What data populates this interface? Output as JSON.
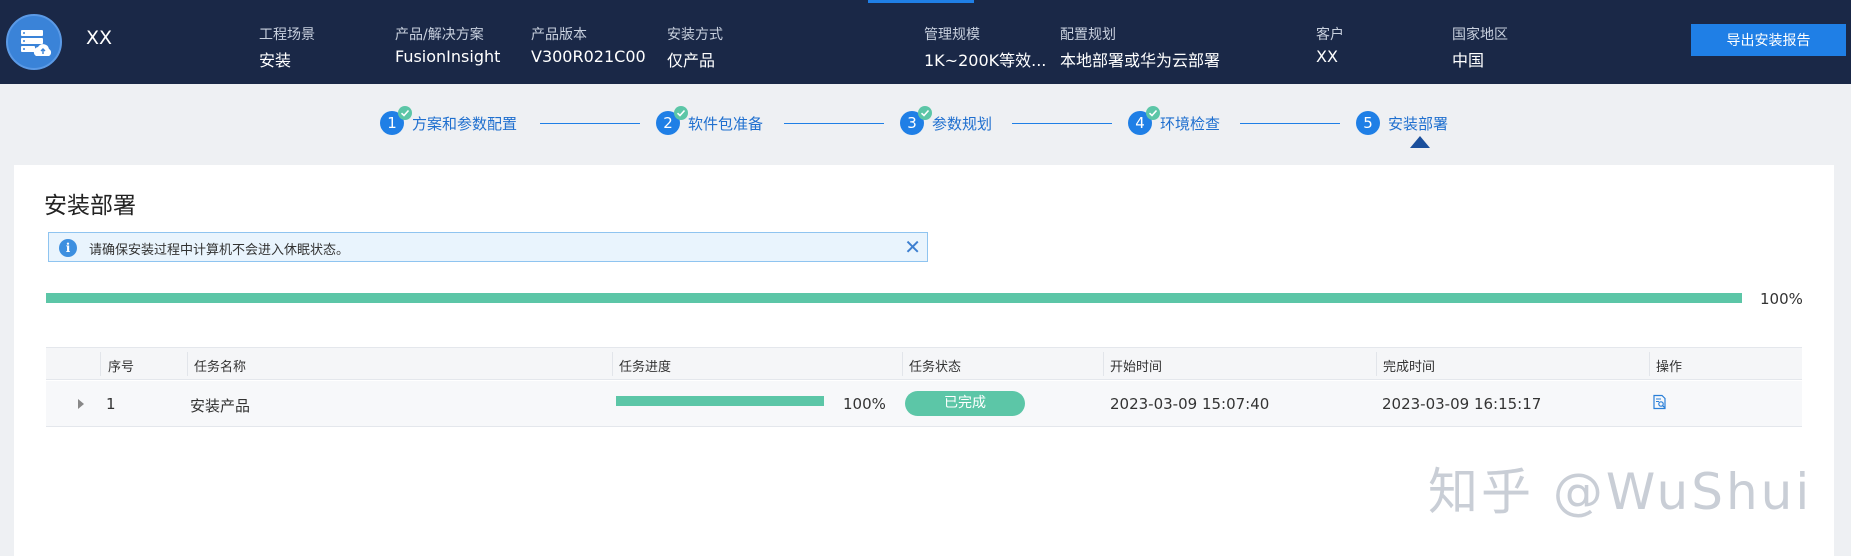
{
  "header": {
    "app_name": "XX",
    "fields": [
      {
        "key": "工程场景",
        "value": "安装"
      },
      {
        "key": "产品/解决方案",
        "value": "FusionInsight"
      },
      {
        "key": "产品版本",
        "value": "V300R021C00"
      },
      {
        "key": "安装方式",
        "value": "仅产品"
      },
      {
        "key": "管理规模",
        "value": "1K~200K等效..."
      },
      {
        "key": "配置规划",
        "value": "本地部署或华为云部署"
      },
      {
        "key": "客户",
        "value": "XX"
      },
      {
        "key": "国家地区",
        "value": "中国"
      }
    ],
    "export_label": "导出安装报告",
    "accent_color": "#1f7fe6",
    "bg_color": "#1a2847"
  },
  "steps": [
    {
      "num": "1",
      "label": "方案和参数配置",
      "done": true
    },
    {
      "num": "2",
      "label": "软件包准备",
      "done": true
    },
    {
      "num": "3",
      "label": "参数规划",
      "done": true
    },
    {
      "num": "4",
      "label": "环境检查",
      "done": true
    },
    {
      "num": "5",
      "label": "安装部署",
      "done": false,
      "current": true
    }
  ],
  "main": {
    "title": "安装部署",
    "alert": {
      "text": "请确保安装过程中计算机不会进入休眠状态。",
      "icon": "info-icon"
    },
    "overall_progress": 1.0,
    "overall_progress_label": "100%",
    "progress_color": "#5cc6a7"
  },
  "table": {
    "columns": [
      "序号",
      "任务名称",
      "任务进度",
      "任务状态",
      "开始时间",
      "完成时间",
      "操作"
    ],
    "rows": [
      {
        "index": "1",
        "name": "安装产品",
        "progress": 1.0,
        "progress_label": "100%",
        "status": "已完成",
        "start": "2023-03-09 15:07:40",
        "end": "2023-03-09 16:15:17",
        "action_icon": "view-details-icon"
      }
    ]
  },
  "watermark": "知乎 @WuShui"
}
